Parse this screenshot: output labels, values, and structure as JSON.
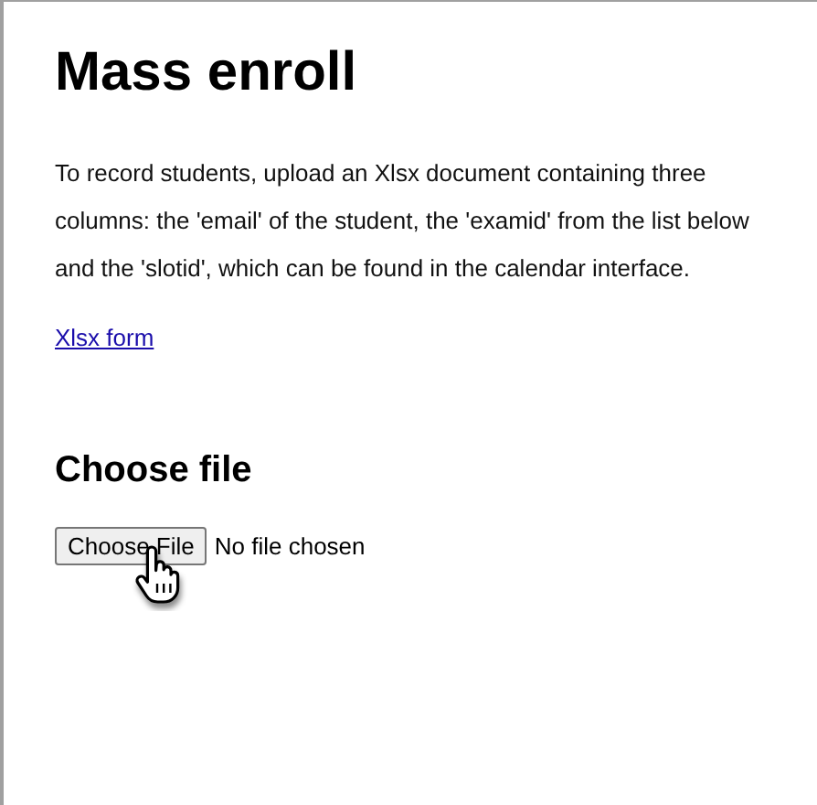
{
  "title": "Mass enroll",
  "description": "To record students, upload an Xlsx document containing three columns: the 'email' of the student, the 'examid' from the list below and the 'slotid', which can be found in the calendar interface.",
  "link": "Xlsx form",
  "section_title": "Choose file",
  "file_input": {
    "button": "Choose File",
    "status": "No file chosen"
  }
}
